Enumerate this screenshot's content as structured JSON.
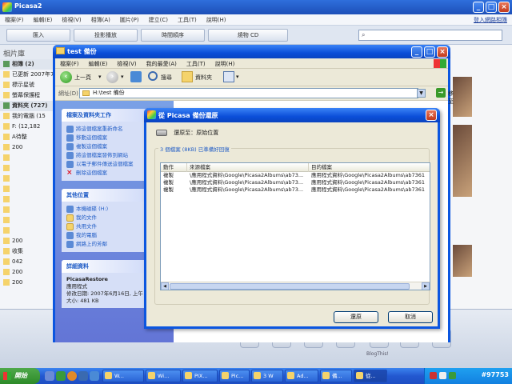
{
  "picasa": {
    "title": "Picasa2",
    "menu": [
      "檔案(F)",
      "編輯(E)",
      "檢視(V)",
      "相簿(A)",
      "圖片(P)",
      "建立(C)",
      "工具(T)",
      "說明(H)"
    ],
    "signin": "登入網路相簿",
    "toolbar": [
      "匯入",
      "投影播放",
      "時間順序",
      "燒物 CD"
    ],
    "library_title": "相片庫",
    "library_rows": [
      {
        "label": "相簿 (2)",
        "section": true
      },
      {
        "label": "已更新 2007年7",
        "section": false
      },
      {
        "label": "標示星號",
        "section": false
      },
      {
        "label": "螢幕保護程",
        "section": false
      },
      {
        "label": "資料夾 (727)",
        "section": true
      },
      {
        "label": "我的電腦 (15",
        "section": false
      },
      {
        "label": "F: (12,182",
        "section": false
      },
      {
        "label": "A待整",
        "section": false
      },
      {
        "label": "200",
        "section": false
      },
      {
        "label": "",
        "section": false
      },
      {
        "label": "",
        "section": false
      },
      {
        "label": "",
        "section": false
      },
      {
        "label": "",
        "section": false
      },
      {
        "label": "",
        "section": false
      },
      {
        "label": "",
        "section": false
      },
      {
        "label": "",
        "section": false
      },
      {
        "label": "",
        "section": false
      },
      {
        "label": "200",
        "section": false
      },
      {
        "label": "收集",
        "section": false
      },
      {
        "label": "042",
        "section": false
      },
      {
        "label": "200",
        "section": false
      },
      {
        "label": "200",
        "section": false
      }
    ],
    "bottom_labels": [
      "BlogThis!"
    ]
  },
  "explorer": {
    "title": "test 備份",
    "menu": [
      "檔案(F)",
      "編輯(E)",
      "檢視(V)",
      "我的最愛(A)",
      "工具(T)",
      "說明(H)"
    ],
    "back_label": "上一頁",
    "search_label": "搜尋",
    "folders_label": "資料夾",
    "address_label": "網址(D)",
    "address_value": "H:\\test 備份",
    "go_label": "移至",
    "tasks_title": "檔案及資料夾工作",
    "tasks": [
      {
        "icon": "rename-icon",
        "label": "將這個檔案重新命名"
      },
      {
        "icon": "move-icon",
        "label": "移動這個檔案"
      },
      {
        "icon": "copy-icon",
        "label": "複製這個檔案"
      },
      {
        "icon": "web-publish-icon",
        "label": "將這個檔案發佈到網站"
      },
      {
        "icon": "email-icon",
        "label": "以電子郵件傳送這個檔案"
      },
      {
        "icon": "delete-icon",
        "label": "刪除這個檔案"
      }
    ],
    "other_title": "其他位置",
    "other_places": [
      "本機磁碟 (H:)",
      "我的文件",
      "共用文件",
      "我的電腦",
      "網路上的芳鄰"
    ],
    "details_title": "詳細資料",
    "details": {
      "name": "PicasaRestore",
      "type": "應用程式",
      "modified": "修改日期: 2007年6月16日, 上午 07:15",
      "size": "大小: 481 KB"
    }
  },
  "dialog": {
    "title": "從 Picasa 備份還原",
    "restore_to": "還原至：原始位置",
    "group_label": "3 個檔案 (8KB) 已準備好回復",
    "columns": [
      "動作",
      "來源檔案",
      "目的檔案"
    ],
    "rows": [
      {
        "action": "複製",
        "source": "\\應用程式資料\\Google\\Picasa2Albums\\ab73...",
        "dest": "應用程式資料\\Google\\Picasa2Albums\\ab7361"
      },
      {
        "action": "複製",
        "source": "\\應用程式資料\\Google\\Picasa2Albums\\ab73...",
        "dest": "應用程式資料\\Google\\Picasa2Albums\\ab7361"
      },
      {
        "action": "複製",
        "source": "\\應用程式資料\\Google\\Picasa2Albums\\ab73...",
        "dest": "應用程式資料\\Google\\Picasa2Albums\\ab7361"
      }
    ],
    "restore_button": "還原",
    "cancel_button": "取消"
  },
  "taskbar": {
    "start_label": "開始",
    "tasks": [
      "W...",
      "Wi...",
      "PIX...",
      "Pic...",
      "3 W",
      "Ad...",
      "備...",
      "從..."
    ],
    "clock": "#97753"
  }
}
